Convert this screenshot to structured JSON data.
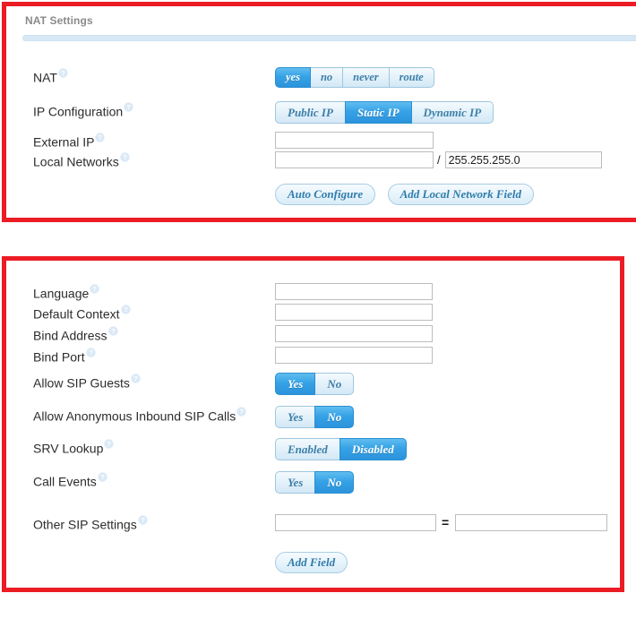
{
  "theme": {
    "highlight_border": "#ec1c24",
    "accent_active": "#36a2e6",
    "accent_text": "#3d7fa8",
    "header_text": "#8a8a8a",
    "rule": "#d7e8f4"
  },
  "nat_panel": {
    "title": "NAT Settings",
    "rows": {
      "nat": {
        "label": "NAT",
        "help": "help-icon",
        "options": [
          "yes",
          "no",
          "never",
          "route"
        ],
        "selected": "yes"
      },
      "ip_configuration": {
        "label": "IP Configuration",
        "help": "help-icon",
        "options": [
          "Public IP",
          "Static IP",
          "Dynamic IP"
        ],
        "selected": "Static IP"
      },
      "external_ip": {
        "label": "External IP",
        "help": "help-icon",
        "value": "",
        "placeholder": ""
      },
      "local_networks": {
        "label": "Local Networks",
        "help": "help-icon",
        "value": "",
        "placeholder": "",
        "separator": "/",
        "netmask_value": "255.255.255.0",
        "netmask_placeholder": ""
      }
    },
    "buttons": {
      "auto_configure": "Auto Configure",
      "add_local_network_field": "Add Local Network Field"
    }
  },
  "sip_panel": {
    "rows": {
      "language": {
        "label": "Language",
        "help": "help-icon",
        "value": "",
        "placeholder": ""
      },
      "default_context": {
        "label": "Default Context",
        "help": "help-icon",
        "value": "",
        "placeholder": ""
      },
      "bind_address": {
        "label": "Bind Address",
        "help": "help-icon",
        "value": "",
        "placeholder": ""
      },
      "bind_port": {
        "label": "Bind Port",
        "help": "help-icon",
        "value": "",
        "placeholder": ""
      },
      "allow_sip_guests": {
        "label": "Allow SIP Guests",
        "help": "help-icon",
        "options": [
          "Yes",
          "No"
        ],
        "selected": "Yes"
      },
      "allow_anonymous_inbound_sip_calls": {
        "label": "Allow Anonymous Inbound SIP Calls",
        "help": "help-icon",
        "options": [
          "Yes",
          "No"
        ],
        "selected": "No"
      },
      "srv_lookup": {
        "label": "SRV Lookup",
        "help": "help-icon",
        "options": [
          "Enabled",
          "Disabled"
        ],
        "selected": "Disabled"
      },
      "call_events": {
        "label": "Call Events",
        "help": "help-icon",
        "options": [
          "Yes",
          "No"
        ],
        "selected": "No"
      },
      "other_sip_settings": {
        "label": "Other SIP Settings",
        "help": "help-icon",
        "key_value": "",
        "key_placeholder": "",
        "separator": "=",
        "value_value": "",
        "value_placeholder": ""
      }
    },
    "buttons": {
      "add_field": "Add Field"
    }
  }
}
